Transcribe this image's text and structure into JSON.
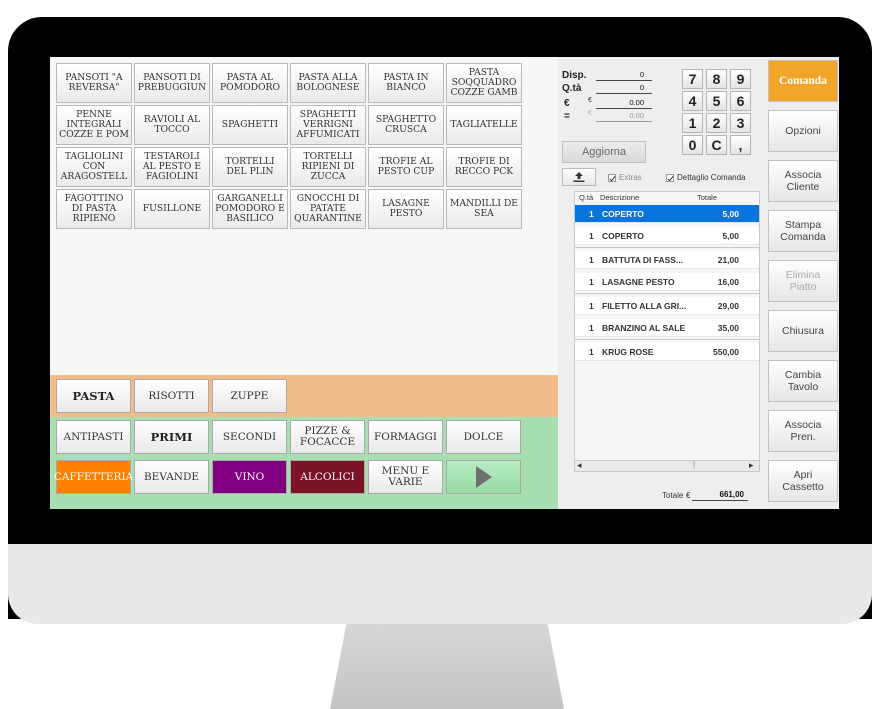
{
  "dishes": [
    "PANSOTI \"A\nREVERSA\"",
    "PANSOTI DI\nPREBUGGIUN",
    "PASTA AL\nPOMODORO",
    "PASTA ALLA\nBOLOGNESE",
    "PASTA IN\nBIANCO",
    "PASTA\nSOQQUADRO\nCOZZE GAMB",
    "PENNE\nINTEGRALI\nCOZZE E POM",
    "RAVIOLI AL\nTOCCO",
    "SPAGHETTI",
    "SPAGHETTI\nVERRIGNI\nAFFUMICATI",
    "SPAGHETTO\nCRUSCA",
    "TAGLIATELLE",
    "TAGLIOLINI\nCON\nARAGOSTELL",
    "TESTAROLI\nAL PESTO E\nFAGIOLINI",
    "TORTELLI\nDEL PLIN",
    "TORTELLI\nRIPIENI DI\nZUCCA",
    "TROFIE AL\nPESTO CUP",
    "TROFIE DI\nRECCO PCK",
    "FAGOTTINO\nDI PASTA\nRIPIENO",
    "FUSILLONE",
    "GARGANELLI\nPOMODORO E\nBASILICO",
    "GNOCCHI DI\nPATATE\nQUARANTINE",
    "LASAGNE\nPESTO",
    "MANDILLI DE\nSEA"
  ],
  "subcategories": {
    "pasta": "PASTA",
    "risotti": "RISOTTI",
    "zuppe": "ZUPPE"
  },
  "categories": {
    "antipasti": "ANTIPASTI",
    "primi": "PRIMI",
    "secondi": "SECONDI",
    "pizze": "PIZZE &\nFOCACCE",
    "formaggi": "FORMAGGI",
    "dolce": "DOLCE",
    "caffetteria": "CAFFETTERIA",
    "bevande": "BEVANDE",
    "vino": "VINO",
    "alcolici": "ALCOLICI",
    "menu": "MENU E\nVARIE"
  },
  "colors": {
    "caffetteria": "#ff7f00",
    "vino": "#800080",
    "alcolici": "#7a1228",
    "selected_row": "#0a74dd",
    "comanda": "#f1a52a"
  },
  "input": {
    "disp_label": "Disp.",
    "disp_value": "0",
    "qta_label": "Q.tà",
    "qta_value": "0",
    "euro_label": "€",
    "euro_prefix": "€",
    "euro_value": "0.00",
    "eq_label": "=",
    "eq_prefix": "€",
    "eq_value": "0.00"
  },
  "keypad": [
    "7",
    "8",
    "9",
    "4",
    "5",
    "6",
    "1",
    "2",
    "3",
    "0",
    "C",
    ","
  ],
  "aggiorna_label": "Aggiorna",
  "upload_icon": "upload-icon",
  "extras_label": "Extras",
  "dettaglio_label": "Dettaglio Comanda",
  "table": {
    "col_qta": "Q.tà",
    "col_desc": "Descrizione",
    "col_total": "Totale",
    "rows": [
      {
        "qty": "1",
        "desc": "COPERTO",
        "total": "5,00"
      },
      {
        "qty": "1",
        "desc": "COPERTO",
        "total": "5,00"
      },
      {
        "qty": "1",
        "desc": "BATTUTA DI FASS...",
        "total": "21,00"
      },
      {
        "qty": "1",
        "desc": "LASAGNE PESTO",
        "total": "16,00"
      },
      {
        "qty": "1",
        "desc": "FILETTO ALLA GRI...",
        "total": "29,00"
      },
      {
        "qty": "1",
        "desc": "BRANZINO AL SALE",
        "total": "35,00"
      },
      {
        "qty": "1",
        "desc": "KRUG ROSE",
        "total": "550,00"
      }
    ]
  },
  "totale": {
    "label": "Totale",
    "currency": "€",
    "value": "661,00"
  },
  "actions": {
    "comanda": "Comanda",
    "opzioni": "Opzioni",
    "associa_cliente": "Associa\nCliente",
    "stampa_comanda": "Stampa\nComanda",
    "elimina_piatto": "Elimina\nPiatto",
    "chiusura": "Chiusura",
    "cambia_tavolo": "Cambia\nTavolo",
    "associa_pren": "Associa\nPren.",
    "apri_cassetto": "Apri\nCassetto"
  }
}
